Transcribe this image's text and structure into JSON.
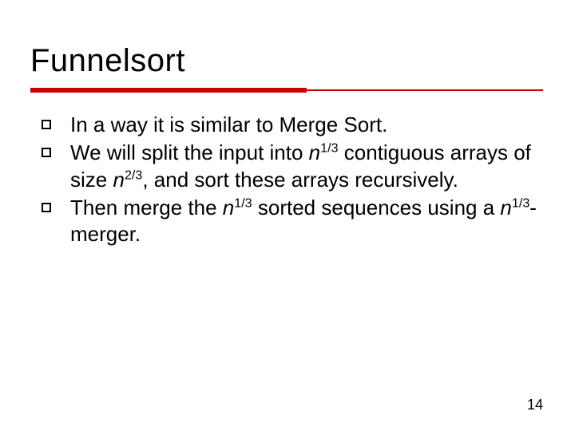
{
  "title": "Funnelsort",
  "bullets": {
    "b1": "In a way it is similar to Merge Sort.",
    "b2_a": "We will split the input into ",
    "b2_n1": "n",
    "b2_e1": "1/3",
    "b2_b": " contiguous arrays of size ",
    "b2_n2": "n",
    "b2_e2": "2/3",
    "b2_c": ", and sort these arrays recursively.",
    "b3_a": "Then merge the ",
    "b3_n1": "n",
    "b3_e1": "1/3",
    "b3_b": " sorted sequences using a ",
    "b3_n2": "n",
    "b3_e2": "1/3",
    "b3_c": "-merger."
  },
  "page_number": "14"
}
